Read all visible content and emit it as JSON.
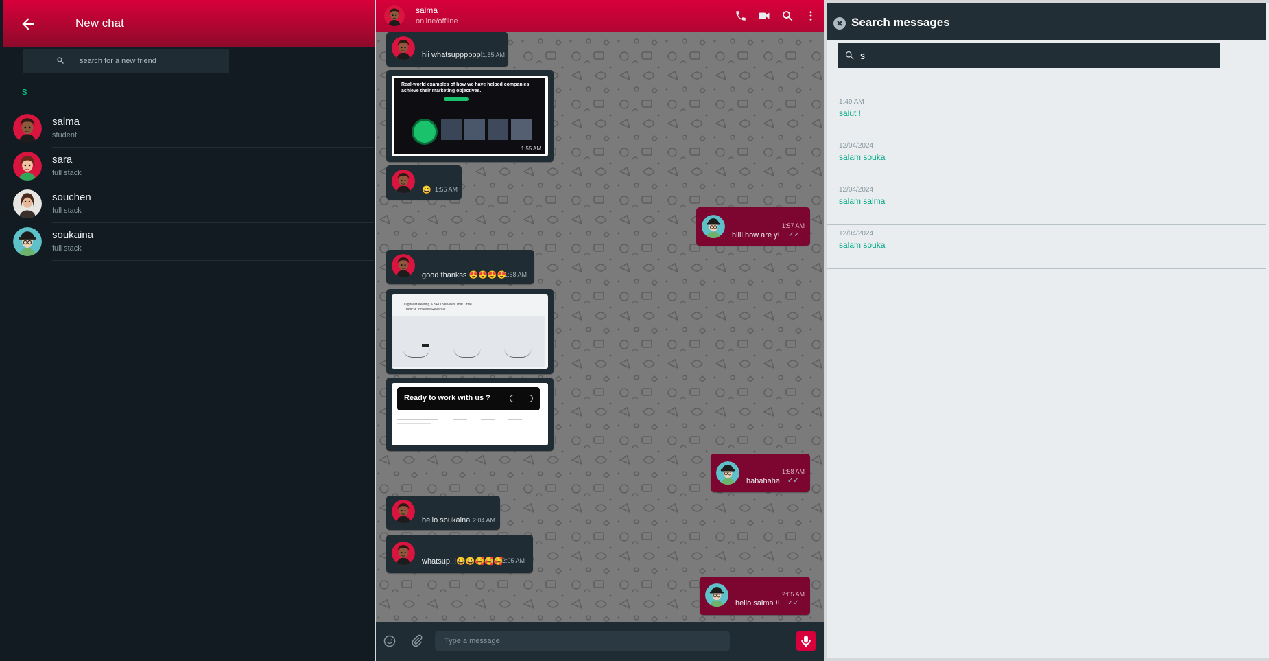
{
  "left_panel": {
    "title": "New chat",
    "search_placeholder": "search for a new friend",
    "group_letter": "s",
    "contacts": [
      {
        "name": "salma",
        "status": "student"
      },
      {
        "name": "sara",
        "status": "full stack"
      },
      {
        "name": "souchen",
        "status": "full stack"
      },
      {
        "name": "soukaina",
        "status": "full stack"
      }
    ]
  },
  "chat": {
    "contact_name": "salma",
    "contact_status": "online/offline",
    "header_icons": [
      "phone-icon",
      "video-call-icon",
      "search-icon",
      "more-vert-icon"
    ],
    "messages": [
      {
        "text": "hii whatsupppppp!",
        "time": "1:55 AM",
        "dir": "in"
      },
      {
        "image": "Real-world examples of how we have helped companies achieve their marketing objectives.",
        "time": "1:55 AM",
        "dir": "in"
      },
      {
        "text": "😀",
        "time": "1:55 AM",
        "dir": "in"
      },
      {
        "text": "hiiii how are y!",
        "time": "1:57 AM",
        "dir": "out"
      },
      {
        "text": "good thankss 😍😍😍😍",
        "time": "1:58 AM",
        "dir": "in"
      },
      {
        "image": "Digital Marketing & SEO Services That Drive Traffic & Increase Revenue",
        "dir": "in"
      },
      {
        "image": "Ready to work with us ?",
        "dir": "in"
      },
      {
        "text": "hahahaha",
        "time": "1:58 AM",
        "dir": "out"
      },
      {
        "text": "hello soukaina",
        "time": "2:04 AM",
        "dir": "in"
      },
      {
        "text": "whatsup!!!😀😀🥰🥰🥰",
        "time": "2:05 AM",
        "dir": "in"
      },
      {
        "text": "hello salma !!",
        "time": "2:05 AM",
        "dir": "out"
      }
    ],
    "composer_placeholder": "Type a message"
  },
  "search_panel": {
    "title": "Search messages",
    "query": "s",
    "results": [
      {
        "date": "1:49 AM",
        "text": "salut !"
      },
      {
        "date": "12/04/2024",
        "text": "salam souka"
      },
      {
        "date": "12/04/2024",
        "text": "salam salma"
      },
      {
        "date": "12/04/2024",
        "text": "salam souka"
      }
    ]
  },
  "colors": {
    "accent": "#d8003a",
    "outgoing_bubble": "#7d0631",
    "incoming_bubble": "#202c33",
    "panel_bg": "#111b21",
    "green": "#00a884"
  }
}
